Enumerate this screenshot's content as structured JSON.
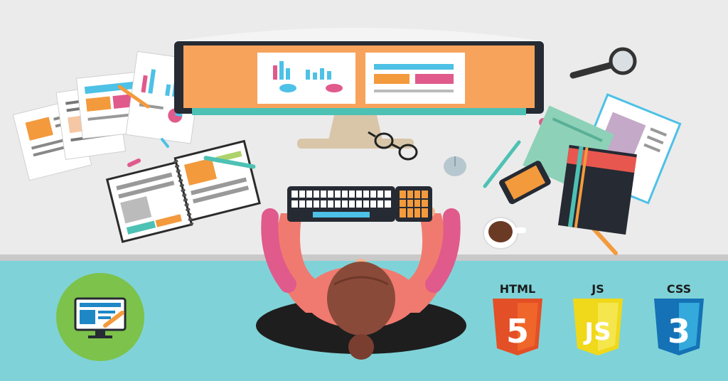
{
  "colors": {
    "desk": "#ebebeb",
    "floor": "#7fd3d8",
    "monitor_frame": "#252a33",
    "screen": "#f7a35c",
    "accent_teal": "#4dc1b4",
    "accent_pink": "#e05a8c",
    "accent_orange": "#f39a3d",
    "shirt": "#f07a6f",
    "hair": "#8a4a3a",
    "chair": "#1e1e1e",
    "green_circle": "#7dc24b",
    "html_orange": "#e34f26",
    "js_yellow": "#f0d81a",
    "css_blue": "#1572b6"
  },
  "icons": {
    "green_badge": "web-design-monitor-icon",
    "html": "html5-shield-icon",
    "js": "javascript-shield-icon",
    "css": "css3-shield-icon"
  },
  "tech_badges": [
    {
      "label": "HTML",
      "number": "5"
    },
    {
      "label": "JS",
      "number": "JS"
    },
    {
      "label": "CSS",
      "number": "3"
    }
  ]
}
